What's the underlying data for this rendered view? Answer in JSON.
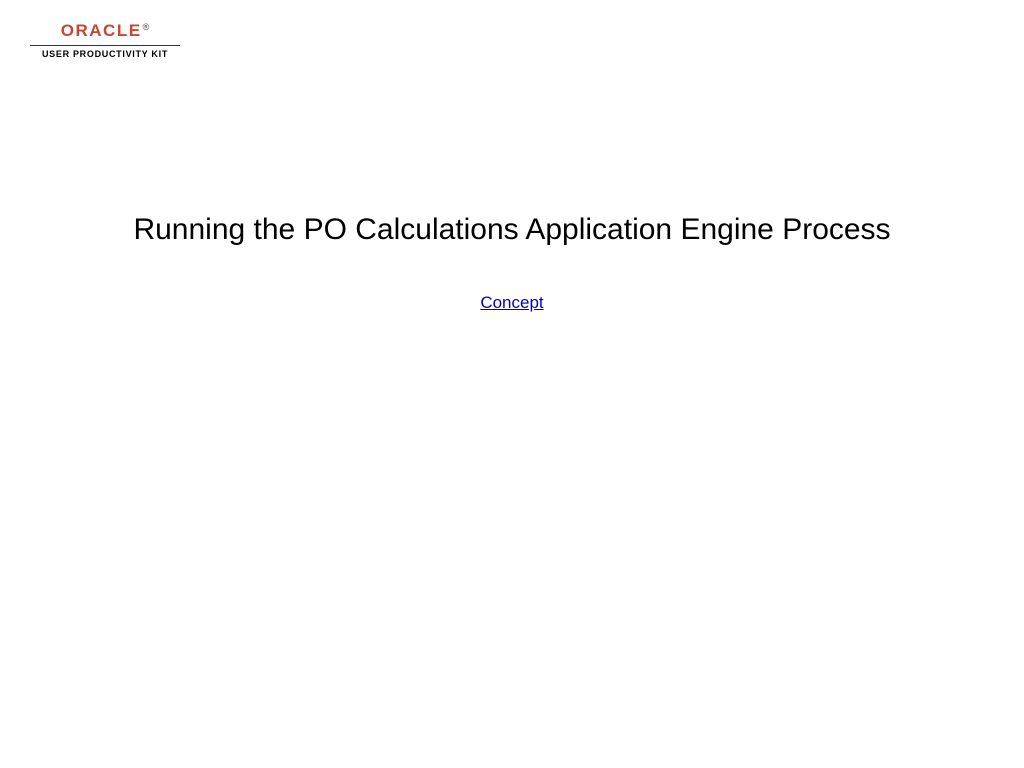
{
  "logo": {
    "brand": "ORACLE",
    "registered": "®",
    "subtitle": "USER PRODUCTIVITY KIT"
  },
  "content": {
    "title": "Running the PO Calculations Application Engine Process",
    "link_label": "Concept"
  }
}
